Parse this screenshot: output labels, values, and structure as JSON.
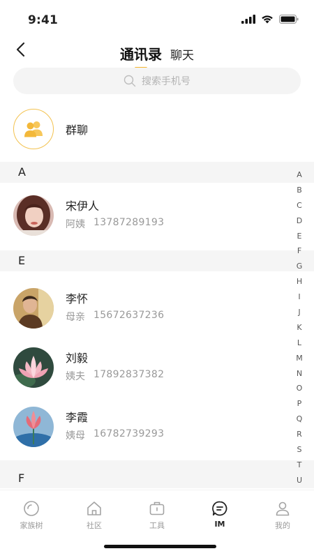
{
  "status": {
    "time": "9:41"
  },
  "header": {
    "tabs": [
      {
        "label": "通讯录",
        "active": true
      },
      {
        "label": "聊天",
        "active": false
      }
    ]
  },
  "search": {
    "placeholder": "搜索手机号"
  },
  "group_chat": {
    "label": "群聊",
    "icon": "group-icon"
  },
  "sections": [
    {
      "letter": "A",
      "contacts": [
        {
          "name": "宋伊人",
          "relation": "阿姨",
          "phone": "13787289193",
          "avatar": "woman-photo"
        }
      ]
    },
    {
      "letter": "E",
      "contacts": [
        {
          "name": "李怀",
          "relation": "母亲",
          "phone": "15672637236",
          "avatar": "man-photo"
        },
        {
          "name": "刘毅",
          "relation": "姨夫",
          "phone": "17892837382",
          "avatar": "lotus-photo"
        },
        {
          "name": "李霞",
          "relation": "姨母",
          "phone": "16782739293",
          "avatar": "lotus-blue-photo"
        }
      ]
    },
    {
      "letter": "F",
      "contacts": []
    }
  ],
  "index_letters": [
    "A",
    "B",
    "C",
    "D",
    "E",
    "F",
    "G",
    "H",
    "I",
    "J",
    "K",
    "L",
    "M",
    "N",
    "O",
    "P",
    "Q",
    "R",
    "S",
    "T",
    "U"
  ],
  "tabbar": [
    {
      "label": "家族树",
      "icon": "family-tree-icon",
      "active": false
    },
    {
      "label": "社区",
      "icon": "home-icon",
      "active": false
    },
    {
      "label": "工具",
      "icon": "toolbox-icon",
      "active": false
    },
    {
      "label": "IM",
      "icon": "chat-icon",
      "active": true
    },
    {
      "label": "我的",
      "icon": "user-icon",
      "active": false
    }
  ],
  "colors": {
    "accent": "#f5b52e",
    "section_bg": "#f5f5f5",
    "muted_text": "#999999"
  }
}
